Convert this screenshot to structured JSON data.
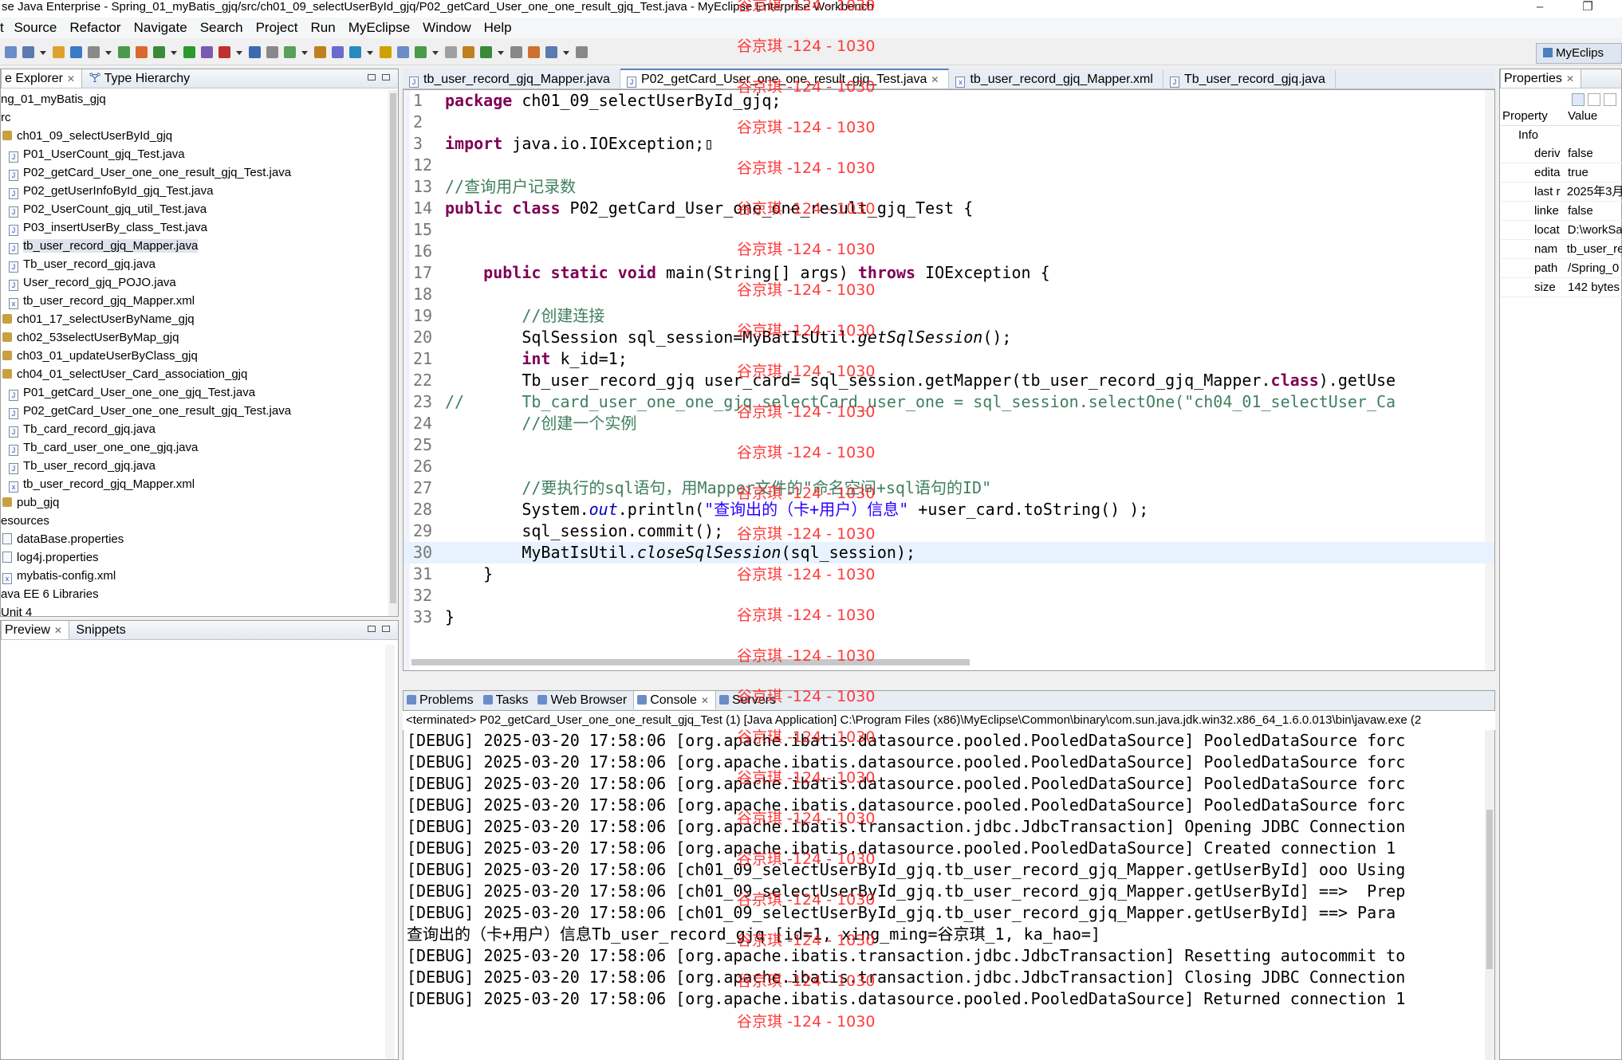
{
  "window": {
    "title": "se Java Enterprise - Spring_01_myBatis_gjq/src/ch01_09_selectUserById_gjq/P02_getCard_User_one_one_result_gjq_Test.java - MyEclipse Enterprise Workbench",
    "restore_glyph": "❐"
  },
  "menu": [
    "Source",
    "Refactor",
    "Navigate",
    "Search",
    "Project",
    "Run",
    "MyEclipse",
    "Window",
    "Help"
  ],
  "menu_prefix": "t",
  "perspective": {
    "label": "MyEclips"
  },
  "explorer": {
    "tabs": [
      "e Explorer",
      "Type Hierarchy"
    ],
    "items": [
      {
        "label": "ng_01_myBatis_gjq",
        "indent": 0,
        "icon": "none"
      },
      {
        "label": "rc",
        "indent": 0,
        "icon": "none"
      },
      {
        "label": "ch01_09_selectUserById_gjq",
        "indent": 0,
        "icon": "package"
      },
      {
        "label": "P01_UserCount_gjq_Test.java",
        "indent": 1,
        "icon": "java"
      },
      {
        "label": "P02_getCard_User_one_one_result_gjq_Test.java",
        "indent": 1,
        "icon": "java"
      },
      {
        "label": "P02_getUserInfoById_gjq_Test.java",
        "indent": 1,
        "icon": "java"
      },
      {
        "label": "P02_UserCount_gjq_util_Test.java",
        "indent": 1,
        "icon": "java"
      },
      {
        "label": "P03_insertUserBy_class_Test.java",
        "indent": 1,
        "icon": "java"
      },
      {
        "label": "tb_user_record_gjq_Mapper.java",
        "indent": 1,
        "icon": "java",
        "selected": true
      },
      {
        "label": "Tb_user_record_gjq.java",
        "indent": 1,
        "icon": "java"
      },
      {
        "label": "User_record_gjq_POJO.java",
        "indent": 1,
        "icon": "java"
      },
      {
        "label": "tb_user_record_gjq_Mapper.xml",
        "indent": 1,
        "icon": "xml"
      },
      {
        "label": "ch01_17_selectUserByName_gjq",
        "indent": 0,
        "icon": "package"
      },
      {
        "label": "ch02_53selectUserByMap_gjq",
        "indent": 0,
        "icon": "package"
      },
      {
        "label": "ch03_01_updateUserByClass_gjq",
        "indent": 0,
        "icon": "package"
      },
      {
        "label": "ch04_01_selectUser_Card_association_gjq",
        "indent": 0,
        "icon": "package"
      },
      {
        "label": "P01_getCard_User_one_one_gjq_Test.java",
        "indent": 1,
        "icon": "java"
      },
      {
        "label": "P02_getCard_User_one_one_result_gjq_Test.java",
        "indent": 1,
        "icon": "java"
      },
      {
        "label": "Tb_card_record_gjq.java",
        "indent": 1,
        "icon": "java"
      },
      {
        "label": "Tb_card_user_one_one_gjq.java",
        "indent": 1,
        "icon": "java"
      },
      {
        "label": "Tb_user_record_gjq.java",
        "indent": 1,
        "icon": "java"
      },
      {
        "label": "tb_user_record_gjq_Mapper.xml",
        "indent": 1,
        "icon": "xml"
      },
      {
        "label": "pub_gjq",
        "indent": 0,
        "icon": "package"
      },
      {
        "label": "esources",
        "indent": 0,
        "icon": "none"
      },
      {
        "label": "dataBase.properties",
        "indent": 0,
        "icon": "file"
      },
      {
        "label": "log4j.properties",
        "indent": 0,
        "icon": "file"
      },
      {
        "label": "mybatis-config.xml",
        "indent": 0,
        "icon": "xml"
      },
      {
        "label": "ava EE 6 Libraries",
        "indent": 0,
        "icon": "none"
      },
      {
        "label": "Unit 4",
        "indent": 0,
        "icon": "none"
      }
    ]
  },
  "preview": {
    "tabs": [
      "Preview",
      "Snippets"
    ]
  },
  "editor": {
    "tabs": [
      {
        "label": "tb_user_record_gjq_Mapper.java",
        "active": false
      },
      {
        "label": "P02_getCard_User_one_one_result_gjq_Test.java",
        "active": true
      },
      {
        "label": "tb_user_record_gjq_Mapper.xml",
        "active": false
      },
      {
        "label": "Tb_user_record_gjq.java",
        "active": false
      }
    ],
    "lines": [
      {
        "n": "1",
        "html": "<span class='kw'>package</span> ch01_09_selectUserById_gjq;"
      },
      {
        "n": "2",
        "html": ""
      },
      {
        "n": "3",
        "html": "<span class='kw'>import</span> java.io.IOException;▯"
      },
      {
        "n": "12",
        "html": ""
      },
      {
        "n": "13",
        "html": "<span class='cm'>//查询用户记录数</span>"
      },
      {
        "n": "14",
        "html": "<span class='kw'>public</span> <span class='kw'>class</span> P02_getCard_User_one_one_result_gjq_Test {"
      },
      {
        "n": "15",
        "html": ""
      },
      {
        "n": "16",
        "html": ""
      },
      {
        "n": "17",
        "html": "    <span class='kw'>public</span> <span class='kw'>static</span> <span class='kw'>void</span> main(String[] args) <span class='kw'>throws</span> IOException {"
      },
      {
        "n": "18",
        "html": ""
      },
      {
        "n": "19",
        "html": "        <span class='cm'>//创建连接</span>"
      },
      {
        "n": "20",
        "html": "        SqlSession sql_session=MyBatIsUtil.<span class='it'>getSqlSession</span>();"
      },
      {
        "n": "21",
        "html": "        <span class='kw'>int</span> k_id=1;"
      },
      {
        "n": "22",
        "html": "        Tb_user_record_gjq user_card= sql_session.getMapper(tb_user_record_gjq_Mapper.<span class='kw'>class</span>).getUse"
      },
      {
        "n": "23",
        "html": "<span class='cm'>//      Tb_card_user_one_one_gjq selectCard_user_one = sql_session.selectOne(\"ch04_01_selectUser_Ca</span>"
      },
      {
        "n": "24",
        "html": "        <span class='cm'>//创建一个实例</span>"
      },
      {
        "n": "25",
        "html": ""
      },
      {
        "n": "26",
        "html": ""
      },
      {
        "n": "27",
        "html": "        <span class='cm'>//要执行的sql语句，用Mapper文件的\"命名空间+sql语句的ID\"</span>"
      },
      {
        "n": "28",
        "html": "        System.<span class='fd'>out</span>.println(<span class='st'>\"查询出的（卡+用户）信息\"</span> +user_card.toString() );"
      },
      {
        "n": "29",
        "html": "        sql_session.commit();"
      },
      {
        "n": "30",
        "html": "        MyBatIsUtil.<span class='it'>closeSqlSession</span>(sql_session);",
        "highlight": true
      },
      {
        "n": "31",
        "html": "    }"
      },
      {
        "n": "32",
        "html": ""
      },
      {
        "n": "33",
        "html": "}"
      }
    ]
  },
  "watermark": "谷京琪 -124 - 1030",
  "console": {
    "tabs": [
      "Problems",
      "Tasks",
      "Web Browser",
      "Console",
      "Servers"
    ],
    "terminated": "<terminated> P02_getCard_User_one_one_result_gjq_Test (1) [Java Application] C:\\Program Files (x86)\\MyEclipse\\Common\\binary\\com.sun.java.jdk.win32.x86_64_1.6.0.013\\bin\\javaw.exe (2",
    "lines": [
      "[DEBUG] 2025-03-20 17:58:06 [org.apache.ibatis.datasource.pooled.PooledDataSource] PooledDataSource forc",
      "[DEBUG] 2025-03-20 17:58:06 [org.apache.ibatis.datasource.pooled.PooledDataSource] PooledDataSource forc",
      "[DEBUG] 2025-03-20 17:58:06 [org.apache.ibatis.datasource.pooled.PooledDataSource] PooledDataSource forc",
      "[DEBUG] 2025-03-20 17:58:06 [org.apache.ibatis.datasource.pooled.PooledDataSource] PooledDataSource forc",
      "[DEBUG] 2025-03-20 17:58:06 [org.apache.ibatis.transaction.jdbc.JdbcTransaction] Opening JDBC Connection",
      "[DEBUG] 2025-03-20 17:58:06 [org.apache.ibatis.datasource.pooled.PooledDataSource] Created connection 1",
      "[DEBUG] 2025-03-20 17:58:06 [ch01_09_selectUserById_gjq.tb_user_record_gjq_Mapper.getUserById] ooo Using",
      "[DEBUG] 2025-03-20 17:58:06 [ch01_09_selectUserById_gjq.tb_user_record_gjq_Mapper.getUserById] ==>  Prep",
      "[DEBUG] 2025-03-20 17:58:06 [ch01_09_selectUserById_gjq.tb_user_record_gjq_Mapper.getUserById] ==> Para",
      "查询出的（卡+用户）信息Tb_user_record_gjq [id=1, xing_ming=谷京琪_1, ka_hao=]",
      "[DEBUG] 2025-03-20 17:58:06 [org.apache.ibatis.transaction.jdbc.JdbcTransaction] Resetting autocommit to",
      "[DEBUG] 2025-03-20 17:58:06 [org.apache.ibatis.transaction.jdbc.JdbcTransaction] Closing JDBC Connection",
      "[DEBUG] 2025-03-20 17:58:06 [org.apache.ibatis.datasource.pooled.PooledDataSource] Returned connection 1"
    ]
  },
  "properties": {
    "tab": "Properties",
    "col_property": "Property",
    "col_value": "Value",
    "group": "Info",
    "rows": [
      {
        "k": "deriv",
        "v": "false"
      },
      {
        "k": "edita",
        "v": "true"
      },
      {
        "k": "last r",
        "v": "2025年3月"
      },
      {
        "k": "linke",
        "v": "false"
      },
      {
        "k": "locat",
        "v": "D:\\workSa"
      },
      {
        "k": "nam",
        "v": "tb_user_re"
      },
      {
        "k": "path",
        "v": "/Spring_0"
      },
      {
        "k": "size",
        "v": "142  bytes"
      }
    ]
  },
  "colors": {
    "watermark": "#ff1a1a",
    "keyword": "#7f0055",
    "comment": "#3f7f5f",
    "string": "#2a00ff"
  }
}
